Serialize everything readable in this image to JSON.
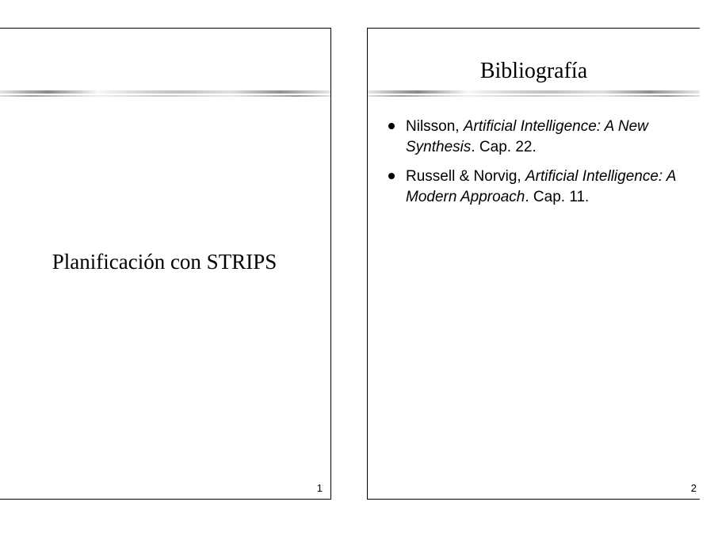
{
  "slides": {
    "left": {
      "main_title": "Planificación con STRIPS",
      "page_number": "1"
    },
    "right": {
      "title": "Bibliografía",
      "bullets": [
        {
          "author": "Nilsson, ",
          "work": "Artificial Intelligence: A New Synthesis",
          "suffix": ". Cap. 22."
        },
        {
          "author": "Russell & Norvig, ",
          "work": "Artificial Intelligence: A Modern Approach",
          "suffix": ". Cap. 11."
        }
      ],
      "page_number": "2"
    }
  }
}
